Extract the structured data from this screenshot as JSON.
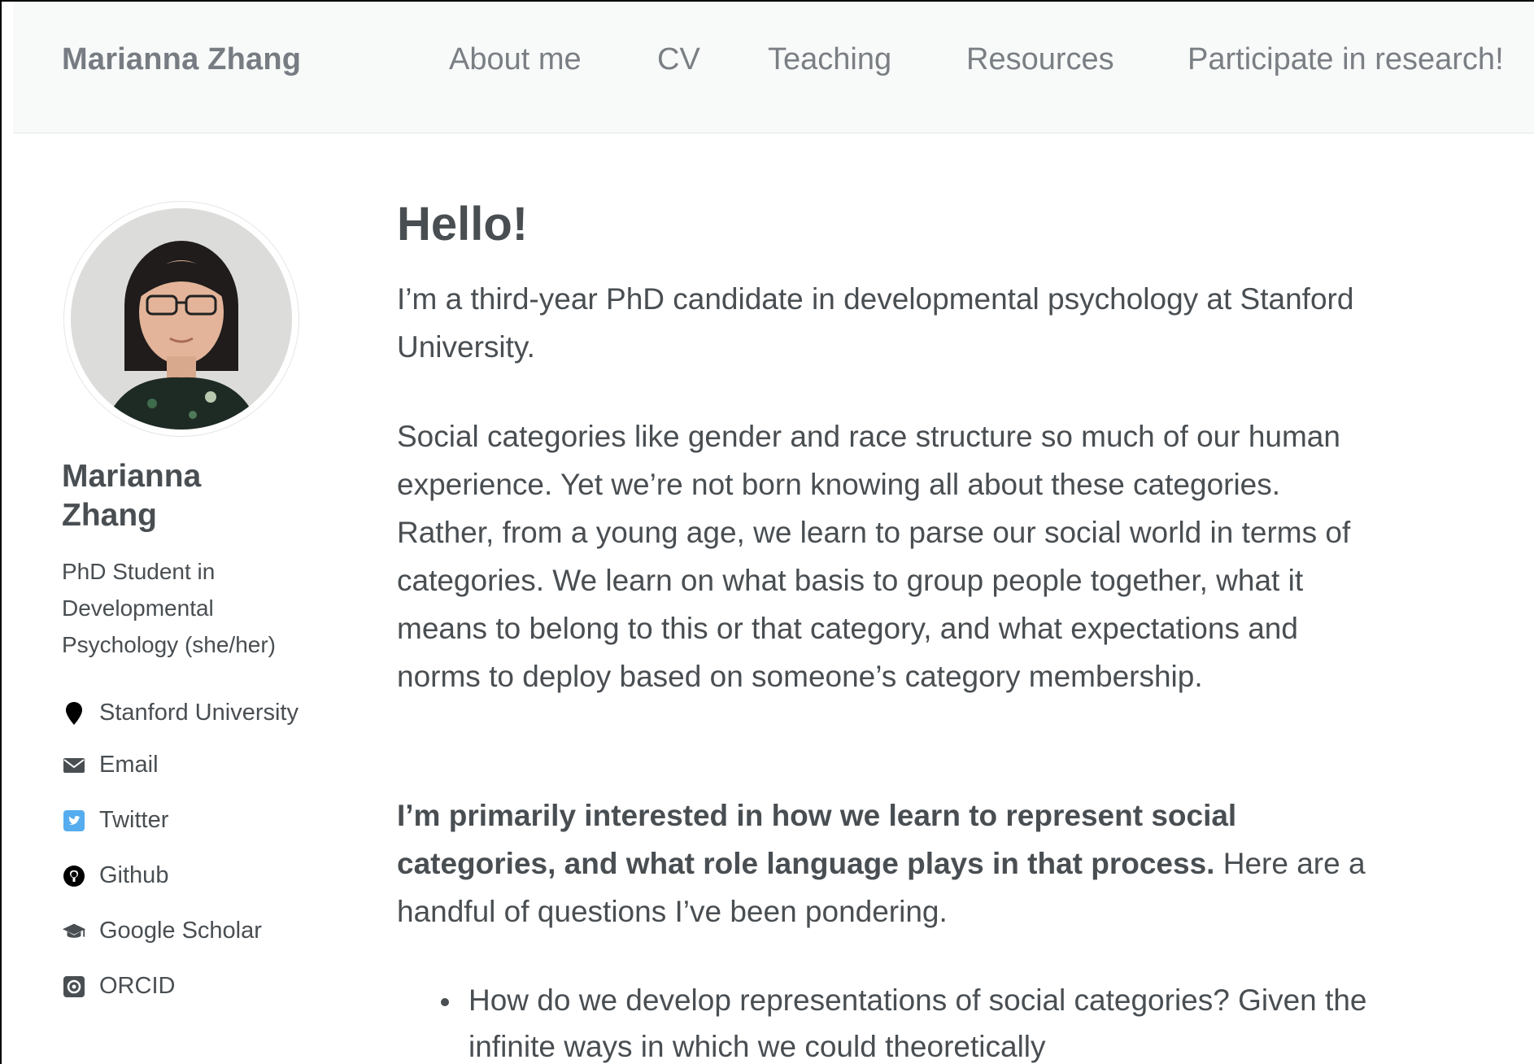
{
  "masthead": {
    "site_title": "Marianna Zhang",
    "nav": [
      {
        "label": "About me"
      },
      {
        "label": "CV"
      },
      {
        "label": "Teaching"
      },
      {
        "label": "Resources"
      },
      {
        "label": "Participate in research!"
      }
    ]
  },
  "sidebar": {
    "name": "Marianna Zhang",
    "bio": "PhD Student in Developmental Psychology (she/her)",
    "links": [
      {
        "label": "Stanford University",
        "icon": "map-marker-icon",
        "color": "#000000"
      },
      {
        "label": "Email",
        "icon": "envelope-icon",
        "color": "#494e52"
      },
      {
        "label": "Twitter",
        "icon": "twitter-icon",
        "color": "#55acee"
      },
      {
        "label": "Github",
        "icon": "github-icon",
        "color": "#000000"
      },
      {
        "label": "Google Scholar",
        "icon": "graduation-cap-icon",
        "color": "#494e52"
      },
      {
        "label": "ORCID",
        "icon": "orcid-icon",
        "color": "#494e52"
      }
    ]
  },
  "main": {
    "title": "Hello!",
    "intro": "I’m a third-year PhD candidate in developmental psychology at Stanford University.",
    "paragraph2": "Social categories like gender and race structure so much of our human experience. Yet we’re not born knowing all about these categories. Rather, from a young age, we learn to parse our social world in terms of categories. We learn on what basis to group people together, what it means to belong to this or that category, and what expectations and norms to deploy based on someone’s category membership.",
    "interest_bold": "I’m primarily interested in how we learn to represent social categories, and what role language plays in that process.",
    "interest_rest": "Here are a handful of questions I’ve been pondering.",
    "questions": [
      "How do we develop representations of social categories? Given the infinite ways in which we could theoretically"
    ]
  },
  "colors": {
    "text": "#494e52",
    "nav_text": "#7a7f84",
    "masthead_bg": "#f8f9f9",
    "twitter": "#55acee"
  }
}
